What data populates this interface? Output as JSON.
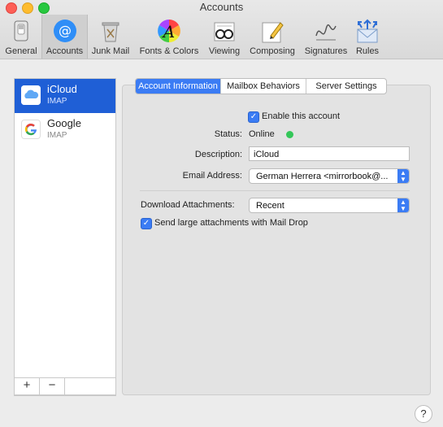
{
  "window": {
    "title": "Accounts"
  },
  "toolbar": {
    "tabs": [
      {
        "label": "General",
        "icon": "general-switch-icon"
      },
      {
        "label": "Accounts",
        "icon": "at-sign-icon"
      },
      {
        "label": "Junk Mail",
        "icon": "trash-can-icon"
      },
      {
        "label": "Fonts & Colors",
        "icon": "color-wheel-icon"
      },
      {
        "label": "Viewing",
        "icon": "glasses-icon"
      },
      {
        "label": "Composing",
        "icon": "pencil-paper-icon"
      },
      {
        "label": "Signatures",
        "icon": "signature-icon"
      },
      {
        "label": "Rules",
        "icon": "envelope-arrows-icon"
      }
    ],
    "active_tab": "Accounts"
  },
  "accounts": [
    {
      "name": "iCloud",
      "type": "IMAP",
      "icon": "icloud-icon",
      "selected": true
    },
    {
      "name": "Google",
      "type": "IMAP",
      "icon": "google-icon",
      "selected": false
    }
  ],
  "list_buttons": {
    "add": "+",
    "remove": "−"
  },
  "detail": {
    "tabs": [
      "Account Information",
      "Mailbox Behaviors",
      "Server Settings"
    ],
    "active_tab": "Account Information",
    "enable_label": "Enable this account",
    "enable_checked": true,
    "status_label": "Status:",
    "status_value": "Online",
    "status_color": "#34c759",
    "description_label": "Description:",
    "description_value": "iCloud",
    "email_label": "Email Address:",
    "email_value": "German Herrera <mirrorbook@...",
    "download_label": "Download Attachments:",
    "download_value": "Recent",
    "mail_drop_label": "Send large attachments with Mail Drop",
    "mail_drop_checked": true
  },
  "help": {
    "label": "?"
  },
  "colors": {
    "accent": "#3b7cf4",
    "selection": "#1f5fd6"
  }
}
